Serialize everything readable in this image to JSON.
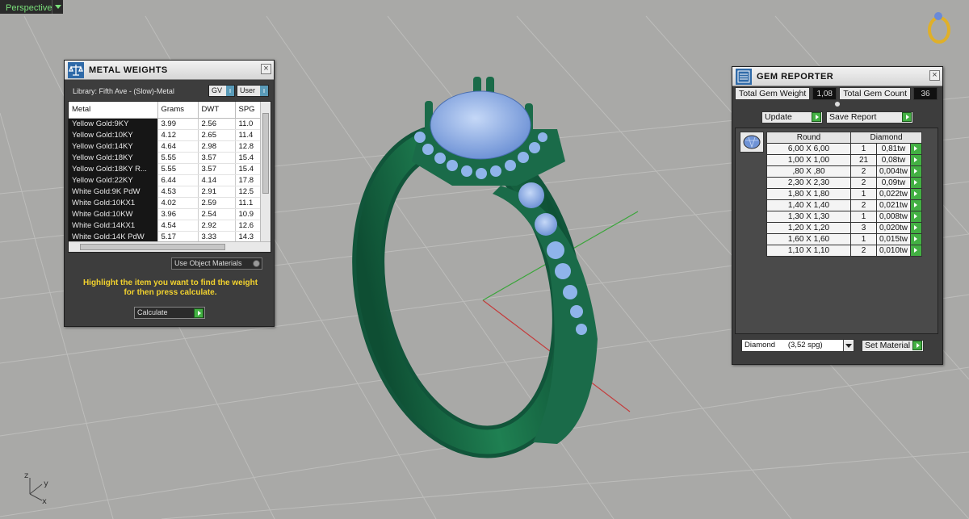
{
  "viewport": {
    "label": "Perspective",
    "axis": {
      "z": "z",
      "y": "y",
      "x": "x"
    },
    "colors": {
      "background": "#a9a9a7",
      "ring": "#1a6b49",
      "gems": "#8fb4ea",
      "axis_x": "#c43b3b",
      "axis_y": "#3aa53a"
    }
  },
  "metal_weights": {
    "title": "METAL WEIGHTS",
    "library_label": "Library: Fifth Ave - (Slow)-Metal",
    "dropdown_gv": "GV",
    "dropdown_user": "User",
    "columns": [
      "Metal",
      "Grams",
      "DWT",
      "SPG"
    ],
    "rows": [
      [
        "Yellow Gold:9KY",
        "3.99",
        "2.56",
        "11.0"
      ],
      [
        "Yellow Gold:10KY",
        "4.12",
        "2.65",
        "11.4"
      ],
      [
        "Yellow Gold:14KY",
        "4.64",
        "2.98",
        "12.8"
      ],
      [
        "Yellow Gold:18KY",
        "5.55",
        "3.57",
        "15.4"
      ],
      [
        "Yellow Gold:18KY R...",
        "5.55",
        "3.57",
        "15.4"
      ],
      [
        "Yellow Gold:22KY",
        "6.44",
        "4.14",
        "17.8"
      ],
      [
        "White Gold:9K PdW",
        "4.53",
        "2.91",
        "12.5"
      ],
      [
        "White Gold:10KX1",
        "4.02",
        "2.59",
        "11.1"
      ],
      [
        "White Gold:10KW",
        "3.96",
        "2.54",
        "10.9"
      ],
      [
        "White Gold:14KX1",
        "4.54",
        "2.92",
        "12.6"
      ],
      [
        "White Gold:14K PdW",
        "5.17",
        "3.33",
        "14.3"
      ]
    ],
    "use_object_materials": "Use Object Materials",
    "message_line1": "Highlight the item you want to find the weight",
    "message_line2": "for then press calculate.",
    "calculate_label": "Calculate",
    "close_label": "×"
  },
  "gem_reporter": {
    "title": "GEM REPORTER",
    "total_weight_label": "Total Gem Weight",
    "total_weight_value": "1,08",
    "total_count_label": "Total Gem Count",
    "total_count_value": "36",
    "update_label": "Update",
    "save_report_label": "Save Report",
    "col_shape": "Round",
    "col_material": "Diamond",
    "rows": [
      [
        "6,00 X 6,00",
        "1",
        "0,81tw"
      ],
      [
        "1,00 X 1,00",
        "21",
        "0,08tw"
      ],
      [
        ",80 X ,80",
        "2",
        "0,004tw"
      ],
      [
        "2,30 X 2,30",
        "2",
        "0,09tw"
      ],
      [
        "1,80 X 1,80",
        "1",
        "0,022tw"
      ],
      [
        "1,40 X 1,40",
        "2",
        "0,021tw"
      ],
      [
        "1,30 X 1,30",
        "1",
        "0,008tw"
      ],
      [
        "1,20 X 1,20",
        "3",
        "0,020tw"
      ],
      [
        "1,60 X 1,60",
        "1",
        "0,015tw"
      ],
      [
        "1,10 X 1,10",
        "2",
        "0,010tw"
      ]
    ],
    "material_select": "Diamond      (3,52 spg)",
    "set_material_label": "Set Material",
    "close_label": "×"
  }
}
